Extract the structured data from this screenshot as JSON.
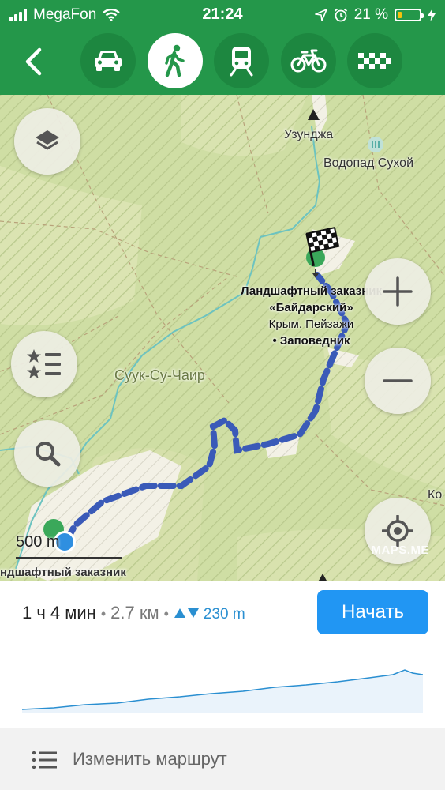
{
  "status_bar": {
    "carrier": "MegaFon",
    "time": "21:24",
    "battery_percent": "21 %",
    "battery_level": 0.21,
    "icons": [
      "signal-icon",
      "wifi-icon",
      "location-arrow-icon",
      "alarm-icon",
      "battery-icon",
      "charging-icon"
    ]
  },
  "header": {
    "back_icon": "chevron-left-icon",
    "modes": [
      {
        "name": "car",
        "icon": "car-icon",
        "active": false
      },
      {
        "name": "walk",
        "icon": "walking-icon",
        "active": true
      },
      {
        "name": "transit",
        "icon": "train-icon",
        "active": false
      },
      {
        "name": "bike",
        "icon": "bicycle-icon",
        "active": false
      },
      {
        "name": "taxi",
        "icon": "taxi-icon",
        "active": false
      }
    ],
    "colors": {
      "bar": "#24974a",
      "button": "#1d8740",
      "active": "#ffffff"
    }
  },
  "map": {
    "labels": {
      "uzundzha": "Узунджа",
      "waterfall": "Водопад Сухой",
      "suuk_su": "Суук-Су-Чаир",
      "edge_right": "Ко",
      "bottom_cut": "ндшафтный заказник"
    },
    "destination": {
      "line1": "Ландшафтный заказник",
      "line2": "«Байдарский»",
      "line3": "Крым. Пейзажи",
      "line4": "• Заповедник"
    },
    "scale": "500 m",
    "watermark": "MAPS.ME",
    "route_color": "#3a5ab8"
  },
  "route": {
    "duration": "1 ч 4 мин",
    "distance": "2.7 км",
    "elevation": "230 m",
    "start_label": "Начать",
    "edit_label": "Изменить маршрут"
  }
}
